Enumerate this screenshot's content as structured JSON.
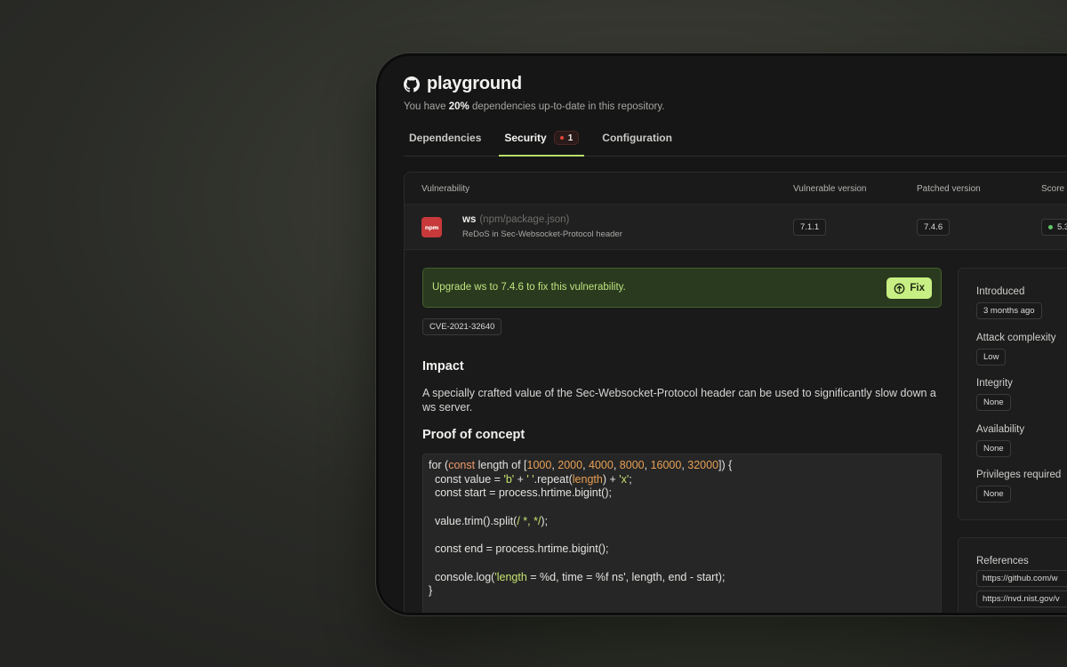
{
  "repo": {
    "name": "playground",
    "subtitle_prefix": "You have ",
    "subtitle_percent": "20%",
    "subtitle_suffix": " dependencies up-to-date in this repository."
  },
  "tabs": [
    {
      "label": "Dependencies"
    },
    {
      "label": "Security",
      "badge_count": "1"
    },
    {
      "label": "Configuration"
    }
  ],
  "table": {
    "headers": [
      "Vulnerability",
      "Vulnerable version",
      "Patched version",
      "Score"
    ],
    "row": {
      "logo_text": "npm",
      "package": "ws",
      "path": "(npm/package.json)",
      "description": "ReDoS in Sec-Websocket-Protocol header",
      "vulnerable_version": "7.1.1",
      "patched_version": "7.4.6",
      "score": "5.3"
    }
  },
  "detail": {
    "upgrade_text": "Upgrade ws to 7.4.6 to fix this vulnerability.",
    "fix_label": "Fix",
    "cve": "CVE-2021-32640",
    "impact_heading": "Impact",
    "impact_text": "A specially crafted value of the Sec-Websocket-Protocol header can be used to significantly slow down a ws server.",
    "poc_heading": "Proof of concept"
  },
  "side": {
    "items": [
      {
        "label": "Introduced",
        "value": "3 months ago"
      },
      {
        "label": "Attack complexity",
        "value": "Low"
      },
      {
        "label": "Integrity",
        "value": "None"
      },
      {
        "label": "Availability",
        "value": "None"
      },
      {
        "label": "Privileges required",
        "value": "None"
      }
    ],
    "references_label": "References",
    "references": [
      "https://github.com/w",
      "https://nvd.nist.gov/v"
    ]
  },
  "colors": {
    "accent": "#b6e06a",
    "fix_button": "#c8ef83",
    "npm_red": "#c7393a",
    "badge_red": "#e0463b",
    "score_green": "#62c46a"
  },
  "icons": {
    "repo": "github-icon",
    "fix": "arrow-up-circle-icon"
  }
}
